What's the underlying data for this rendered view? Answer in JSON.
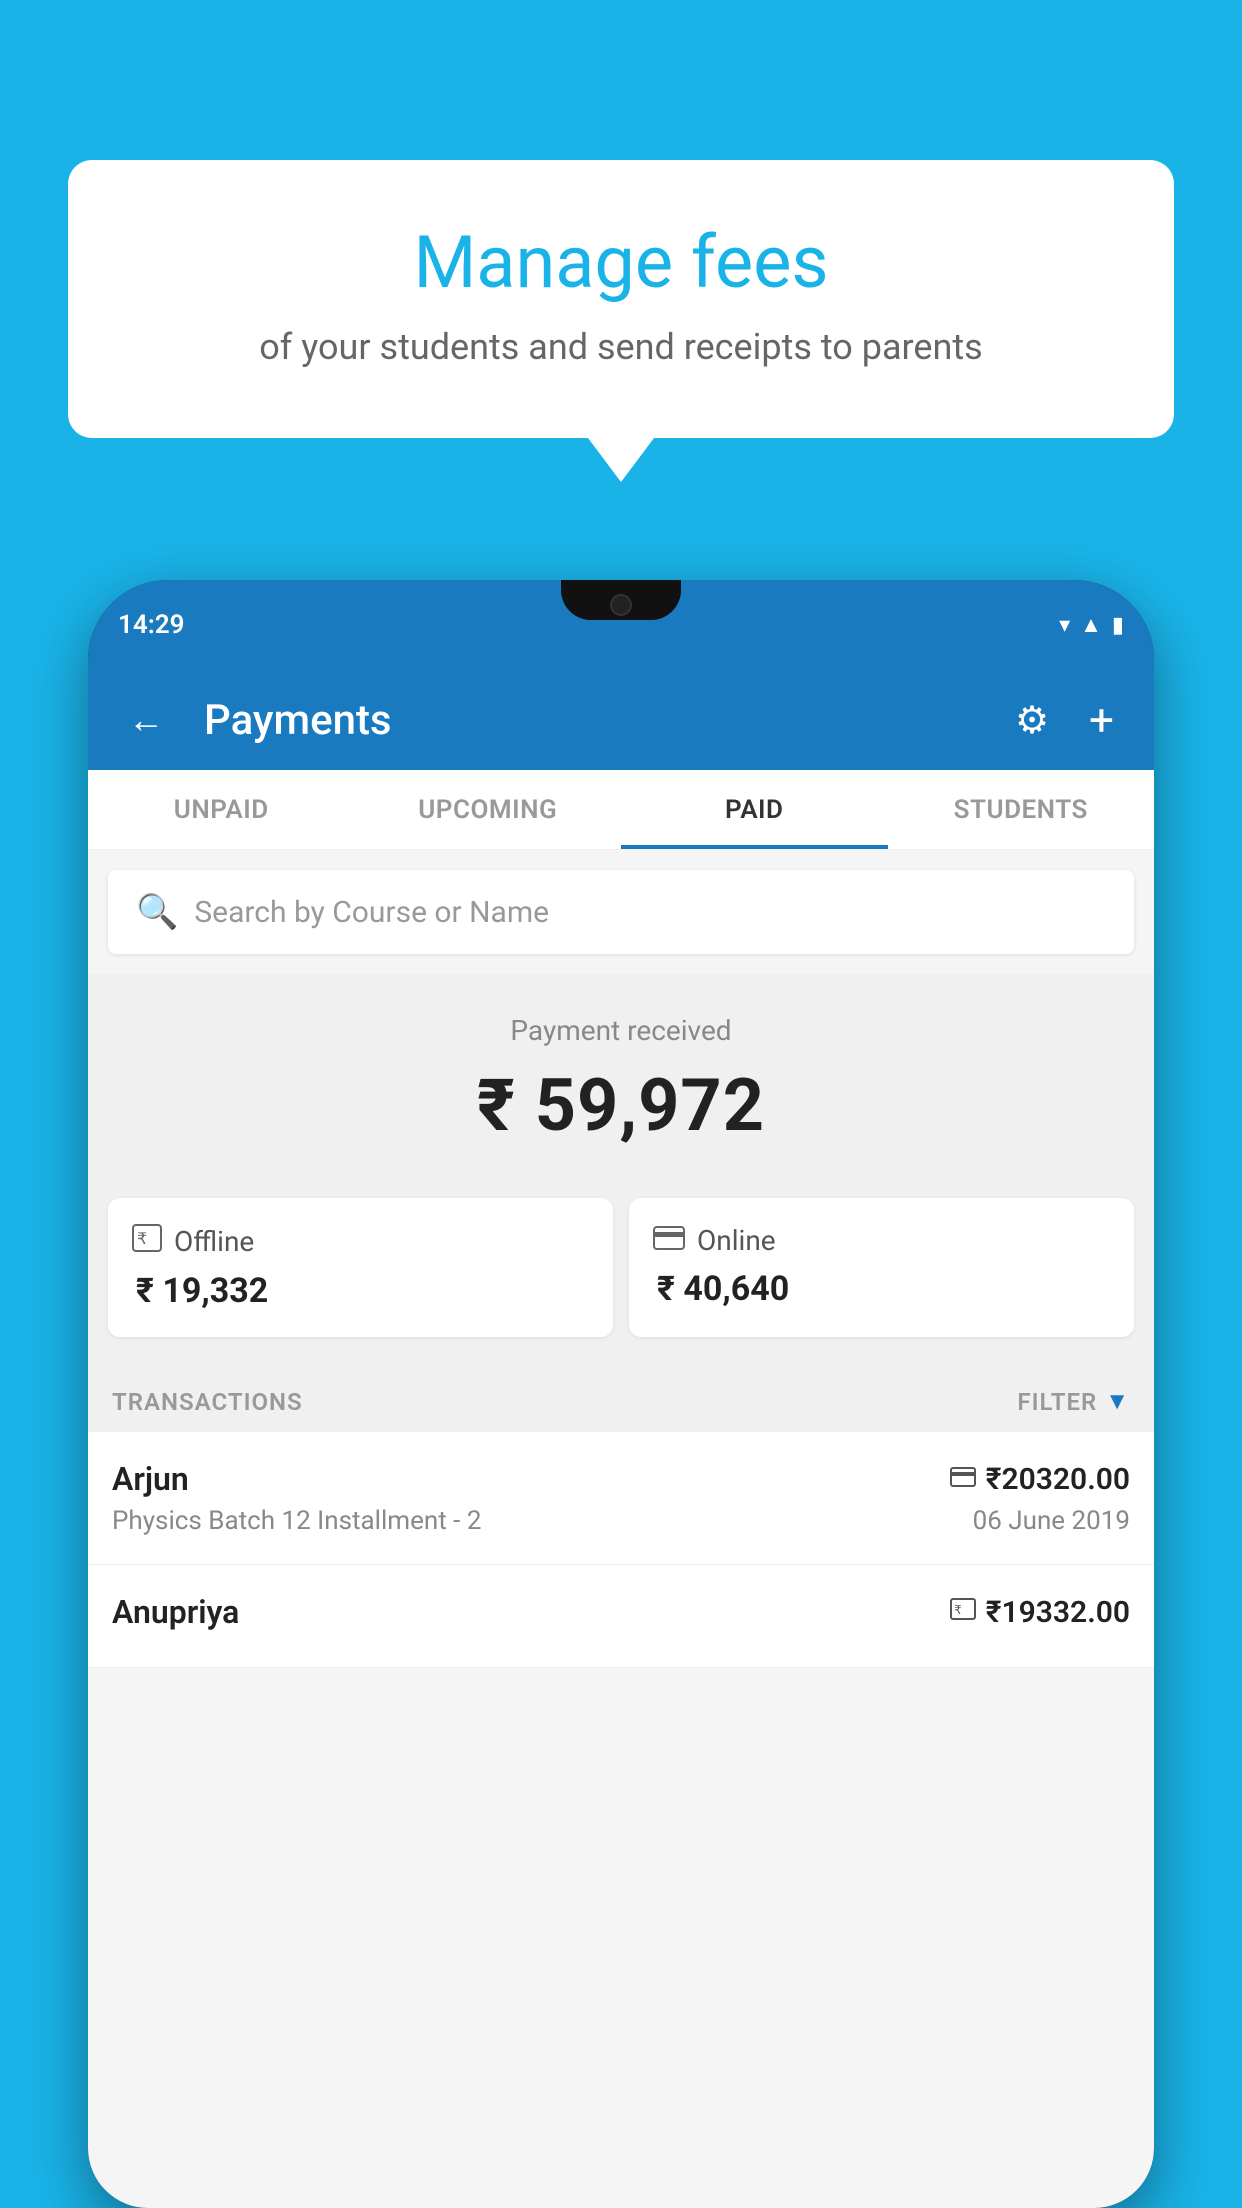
{
  "background_color": "#1ab3e8",
  "bubble": {
    "title": "Manage fees",
    "subtitle": "of your students and send receipts to parents"
  },
  "status_bar": {
    "time": "14:29",
    "icons": [
      "wifi",
      "signal",
      "battery"
    ]
  },
  "header": {
    "title": "Payments",
    "back_label": "←",
    "gear_label": "⚙",
    "plus_label": "+"
  },
  "tabs": [
    {
      "label": "UNPAID",
      "active": false
    },
    {
      "label": "UPCOMING",
      "active": false
    },
    {
      "label": "PAID",
      "active": true
    },
    {
      "label": "STUDENTS",
      "active": false
    }
  ],
  "search": {
    "placeholder": "Search by Course or Name"
  },
  "payment_summary": {
    "label": "Payment received",
    "amount": "₹ 59,972",
    "offline": {
      "type": "Offline",
      "amount": "₹ 19,332"
    },
    "online": {
      "type": "Online",
      "amount": "₹ 40,640"
    }
  },
  "transactions": {
    "header_label": "TRANSACTIONS",
    "filter_label": "FILTER",
    "items": [
      {
        "name": "Arjun",
        "course": "Physics Batch 12 Installment - 2",
        "amount": "₹20320.00",
        "date": "06 June 2019",
        "payment_icon": "card"
      },
      {
        "name": "Anupriya",
        "course": "",
        "amount": "₹19332.00",
        "date": "",
        "payment_icon": "cash"
      }
    ]
  }
}
